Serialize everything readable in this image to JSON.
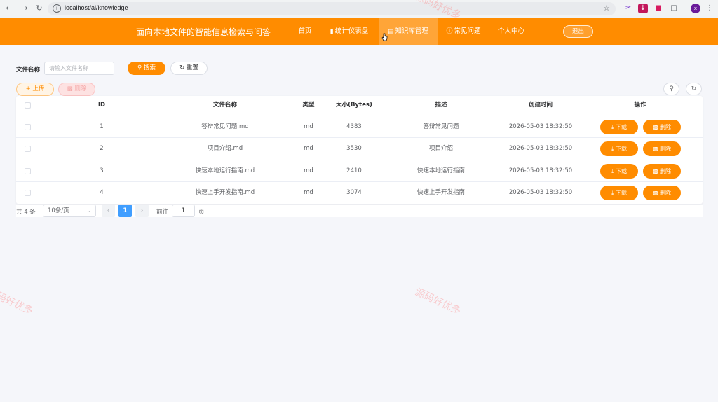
{
  "browser": {
    "url": "localhost/ai/knowledge",
    "profile_initial": "x"
  },
  "header": {
    "title": "面向本地文件的智能信息检索与问答",
    "nav": [
      {
        "label": "首页",
        "icon": ""
      },
      {
        "label": "统计仪表盘",
        "icon": "bar-chart-icon"
      },
      {
        "label": "知识库管理",
        "icon": "document-icon",
        "active": true
      },
      {
        "label": "常见问题",
        "icon": "question-circle-icon"
      },
      {
        "label": "个人中心",
        "icon": ""
      }
    ],
    "logout_label": "退出"
  },
  "filter": {
    "file_name_label": "文件名称",
    "file_name_placeholder": "请输入文件名称",
    "search_label": "搜索",
    "reset_label": "重置"
  },
  "toolbar": {
    "upload_label": "上传",
    "delete_label": "删除"
  },
  "table": {
    "columns": [
      "ID",
      "文件名称",
      "类型",
      "大小(Bytes)",
      "描述",
      "创建时间",
      "操作"
    ],
    "rows": [
      {
        "id": "1",
        "name": "答辩常见问题.md",
        "type": "md",
        "size": "4383",
        "desc": "答辩常见问题",
        "created": "2026-05-03 18:32:50"
      },
      {
        "id": "2",
        "name": "项目介绍.md",
        "type": "md",
        "size": "3530",
        "desc": "项目介绍",
        "created": "2026-05-03 18:32:50"
      },
      {
        "id": "3",
        "name": "快速本地运行指南.md",
        "type": "md",
        "size": "2410",
        "desc": "快速本地运行指南",
        "created": "2026-05-03 18:32:50"
      },
      {
        "id": "4",
        "name": "快速上手开发指南.md",
        "type": "md",
        "size": "3074",
        "desc": "快速上手开发指南",
        "created": "2026-05-03 18:32:50"
      }
    ],
    "download_label": "下载",
    "row_delete_label": "删除"
  },
  "pagination": {
    "total_text": "共 4 条",
    "page_size": "10条/页",
    "current_page": "1",
    "goto_prefix": "前往",
    "goto_value": "1",
    "goto_suffix": "页"
  },
  "watermark": "源码好优多",
  "colors": {
    "brand": "#ff8c00",
    "page_active": "#409eff"
  }
}
